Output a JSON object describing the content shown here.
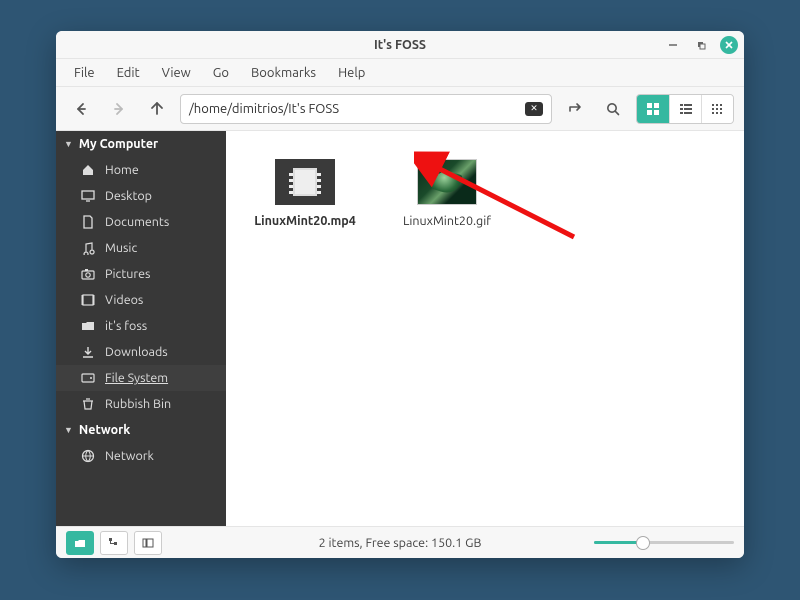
{
  "title": "It's FOSS",
  "menubar": [
    "File",
    "Edit",
    "View",
    "Go",
    "Bookmarks",
    "Help"
  ],
  "path": "/home/dimitrios/It's FOSS",
  "sidebar": {
    "computer_header": "My Computer",
    "items": [
      {
        "icon": "home",
        "label": "Home"
      },
      {
        "icon": "desktop",
        "label": "Desktop"
      },
      {
        "icon": "doc",
        "label": "Documents"
      },
      {
        "icon": "music",
        "label": "Music"
      },
      {
        "icon": "pic",
        "label": "Pictures"
      },
      {
        "icon": "video",
        "label": "Videos"
      },
      {
        "icon": "folder",
        "label": "it's foss"
      },
      {
        "icon": "download",
        "label": "Downloads"
      },
      {
        "icon": "disk",
        "label": "File System",
        "active": true
      },
      {
        "icon": "trash",
        "label": "Rubbish Bin"
      }
    ],
    "network_header": "Network",
    "network_items": [
      {
        "icon": "net",
        "label": "Network"
      }
    ]
  },
  "files": [
    {
      "kind": "mp4",
      "name": "LinuxMint20.mp4",
      "bold": true
    },
    {
      "kind": "gif",
      "name": "LinuxMint20.gif",
      "bold": false
    }
  ],
  "status": "2 items, Free space: 150.1 GB"
}
